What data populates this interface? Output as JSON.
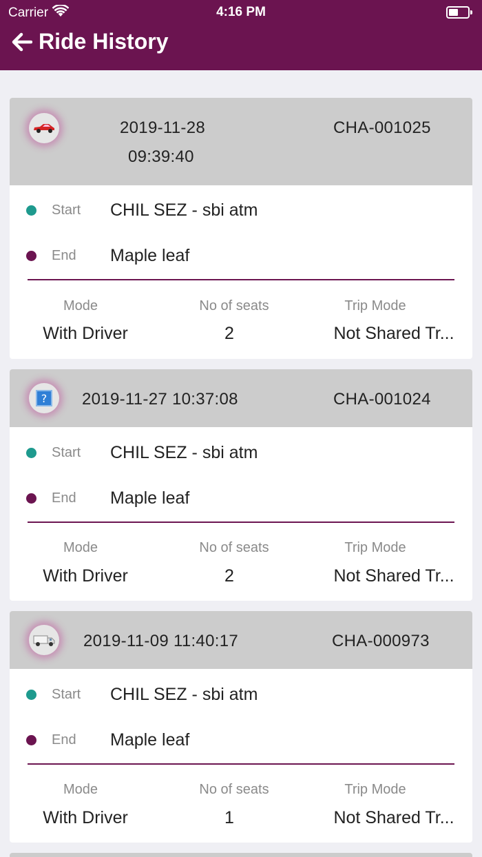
{
  "status_bar": {
    "carrier": "Carrier",
    "time": "4:16 PM"
  },
  "header": {
    "title": "Ride History"
  },
  "labels": {
    "start": "Start",
    "end": "End",
    "mode": "Mode",
    "seats": "No of seats",
    "trip_mode": "Trip Mode"
  },
  "rides": [
    {
      "vehicle_icon": "red-car-icon",
      "date": "2019-11-28",
      "time": "09:39:40",
      "datetime": "2019-11-28 09:39:40",
      "id": "CHA-001025",
      "start": "CHIL SEZ - sbi atm",
      "end": "Maple leaf",
      "mode": "With Driver",
      "seats": "2",
      "trip_mode": "Not Shared Tr..."
    },
    {
      "vehicle_icon": "unknown-image-icon",
      "datetime": "2019-11-27 10:37:08",
      "id": "CHA-001024",
      "start": "CHIL SEZ - sbi atm",
      "end": "Maple leaf",
      "mode": "With Driver",
      "seats": "2",
      "trip_mode": "Not Shared Tr..."
    },
    {
      "vehicle_icon": "truck-icon",
      "datetime": "2019-11-09 11:40:17",
      "id": "CHA-000973",
      "start": "CHIL SEZ - sbi atm",
      "end": "Maple leaf",
      "mode": "With Driver",
      "seats": "1",
      "trip_mode": "Not Shared Tr..."
    }
  ],
  "colors": {
    "brand": "#6b1450",
    "start_dot": "#1e9a8e",
    "end_dot": "#6b1450",
    "card_header": "#cccccc",
    "background": "#efeff4"
  }
}
